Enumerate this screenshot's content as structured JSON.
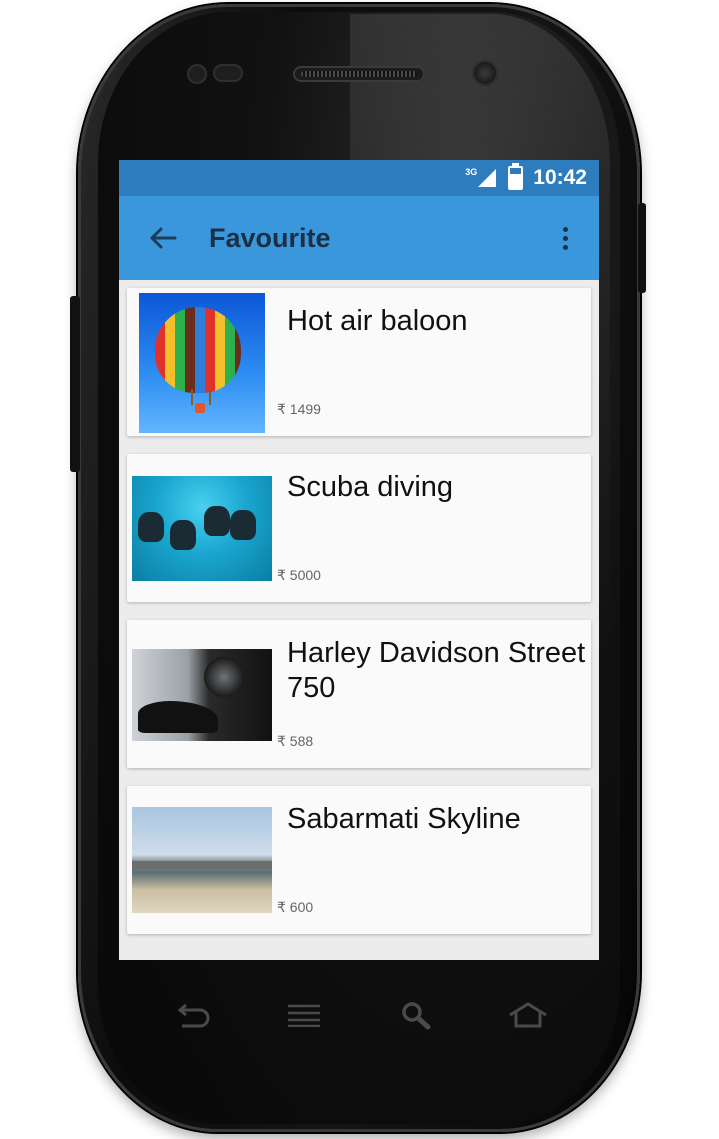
{
  "status_bar": {
    "network": "3G",
    "time": "10:42"
  },
  "app_bar": {
    "title": "Favourite",
    "back_icon": "arrow-back-icon",
    "menu_icon": "overflow-menu-icon"
  },
  "items": [
    {
      "title": "Hot air baloon",
      "price": "₹ 1499",
      "image": "hot-air-balloon-image"
    },
    {
      "title": "Scuba diving",
      "price": "₹ 5000",
      "image": "scuba-divers-image"
    },
    {
      "title": "Harley Davidson Street 750",
      "price": "₹ 588",
      "image": "motorcycle-image"
    },
    {
      "title": "Sabarmati Skyline",
      "price": "₹ 600",
      "image": "riverfront-zipline-image"
    }
  ],
  "soft_keys": [
    "back-icon",
    "menu-icon",
    "search-icon",
    "home-icon"
  ],
  "colors": {
    "status_bar": "#2d7dbe",
    "app_bar": "#3b97dc",
    "list_background": "#ececec",
    "card": "#fafafa"
  }
}
